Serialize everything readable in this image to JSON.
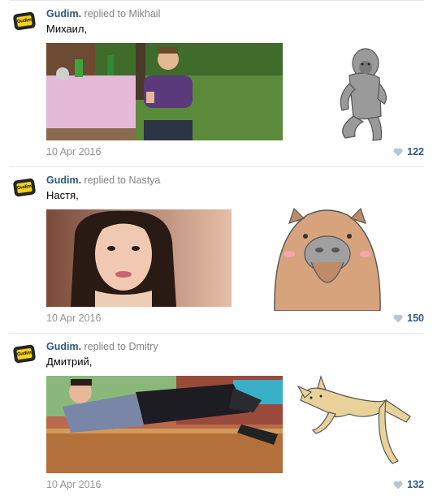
{
  "comments": [
    {
      "author": "Gudim.",
      "replied_label": "replied to",
      "target": "Mikhail",
      "text": "Михаил,",
      "date": "10 Apr 2016",
      "likes": "122",
      "sticker": "bigfoot-sticker"
    },
    {
      "author": "Gudim.",
      "replied_label": "replied to",
      "target": "Nastya",
      "text": "Настя,",
      "date": "10 Apr 2016",
      "likes": "150",
      "sticker": "capybara-sticker"
    },
    {
      "author": "Gudim.",
      "replied_label": "replied to",
      "target": "Dmitry",
      "text": "Дмитрий,",
      "date": "10 Apr 2016",
      "likes": "132",
      "sticker": "cat-sticker"
    }
  ],
  "avatar_text": "Gudim.",
  "colors": {
    "link": "#2a5885",
    "muted": "#828282",
    "date": "#939393",
    "heart": "#b6c6d8",
    "separator": "#e7e8ec"
  }
}
